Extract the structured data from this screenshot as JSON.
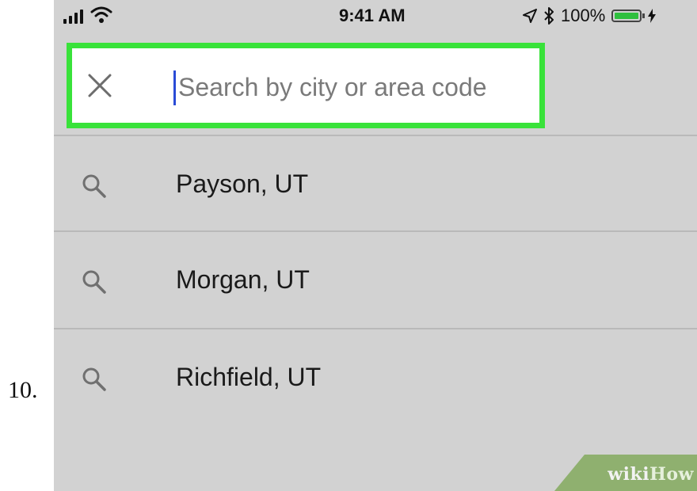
{
  "step": {
    "number": "10."
  },
  "status_bar": {
    "time": "9:41 AM",
    "battery": "100%",
    "battery_level": 1.0,
    "icons": [
      "signal-icon",
      "wifi-icon",
      "location-arrow-icon",
      "bluetooth-icon",
      "battery-icon",
      "charging-bolt-icon"
    ]
  },
  "search": {
    "placeholder": "Search by city or area code",
    "value": "",
    "close_icon": "close-icon",
    "highlight_color": "#39e23a"
  },
  "results": [
    {
      "label": "Payson, UT",
      "icon": "search-icon"
    },
    {
      "label": "Morgan, UT",
      "icon": "search-icon"
    },
    {
      "label": "Richfield, UT",
      "icon": "search-icon"
    }
  ],
  "watermark": {
    "wiki": "wiki",
    "how": "How"
  },
  "colors": {
    "screen_background": "#d2d2d2",
    "search_background": "#ffffff",
    "caret": "#2a4bd6",
    "battery_fill": "#2fbf3e",
    "watermark": "#8fb06f"
  }
}
